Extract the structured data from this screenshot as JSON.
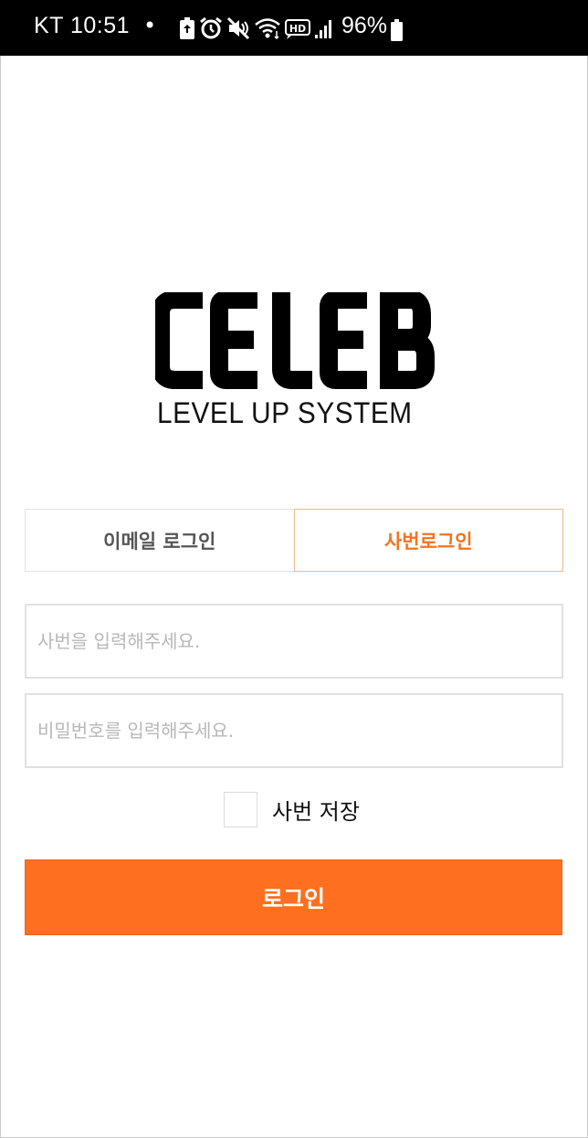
{
  "status_bar": {
    "carrier_time": "KT 10:51",
    "dot": "•",
    "battery_percent": "96%",
    "icons": [
      "battery-saver-icon",
      "alarm-icon",
      "mute-icon",
      "wifi-icon",
      "hd-icon",
      "signal-icon",
      "battery-icon"
    ]
  },
  "logo": {
    "wordmark": "CELEB",
    "tagline": "LEVEL UP SYSTEM"
  },
  "tabs": [
    {
      "label": "이메일 로그인",
      "active": false
    },
    {
      "label": "사번로그인",
      "active": true
    }
  ],
  "form": {
    "employee_id_placeholder": "사번을 입력해주세요.",
    "password_placeholder": "비밀번호를 입력해주세요.",
    "remember_label": "사번 저장",
    "remember_checked": false,
    "login_label": "로그인"
  },
  "colors": {
    "accent": "#fe7020",
    "active_tab_text": "#f47320",
    "inactive_tab_text": "#555555",
    "placeholder": "#b8b8b8"
  }
}
